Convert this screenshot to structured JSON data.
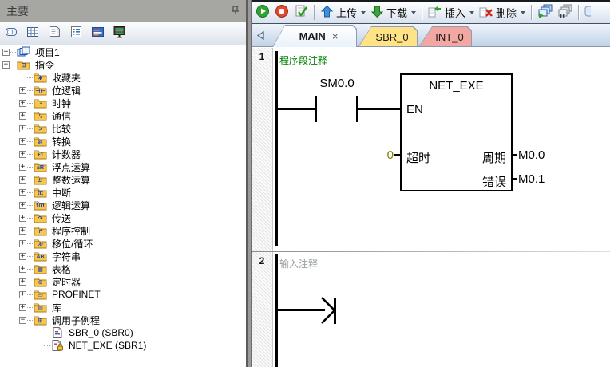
{
  "panel": {
    "title": "主要",
    "toolbar": [
      {
        "name": "frame-view-icon"
      },
      {
        "name": "grid-view-icon"
      },
      {
        "name": "document-view-icon"
      },
      {
        "name": "list-view-icon"
      },
      {
        "name": "block-view-icon"
      },
      {
        "name": "monitor-view-icon"
      }
    ]
  },
  "tree": {
    "items": [
      {
        "label": "项目1",
        "level": 0,
        "expand": "plus",
        "icon": "project",
        "glyph": ""
      },
      {
        "label": "指令",
        "level": 0,
        "expand": "minus",
        "icon": "folder",
        "glyph": "⊡"
      },
      {
        "label": "收藏夹",
        "level": 1,
        "expand": "none",
        "icon": "folder",
        "glyph": "✱"
      },
      {
        "label": "位逻辑",
        "level": 1,
        "expand": "plus",
        "icon": "folder",
        "glyph": "⊣⊢"
      },
      {
        "label": "时钟",
        "level": 1,
        "expand": "plus",
        "icon": "folder",
        "glyph": "◔"
      },
      {
        "label": "通信",
        "level": 1,
        "expand": "plus",
        "icon": "folder",
        "glyph": "ϟ"
      },
      {
        "label": "比较",
        "level": 1,
        "expand": "plus",
        "icon": "folder",
        "glyph": ">"
      },
      {
        "label": "转换",
        "level": 1,
        "expand": "plus",
        "icon": "folder",
        "glyph": "⇄"
      },
      {
        "label": "计数器",
        "level": 1,
        "expand": "plus",
        "icon": "folder",
        "glyph": "+1"
      },
      {
        "label": "浮点运算",
        "level": 1,
        "expand": "plus",
        "icon": "folder",
        "glyph": "±R"
      },
      {
        "label": "整数运算",
        "level": 1,
        "expand": "plus",
        "icon": "folder",
        "glyph": "±I"
      },
      {
        "label": "中断",
        "level": 1,
        "expand": "plus",
        "icon": "folder",
        "glyph": "ttt"
      },
      {
        "label": "逻辑运算",
        "level": 1,
        "expand": "plus",
        "icon": "folder",
        "glyph": "101"
      },
      {
        "label": "传送",
        "level": 1,
        "expand": "plus",
        "icon": "folder",
        "glyph": "↷"
      },
      {
        "label": "程序控制",
        "level": 1,
        "expand": "plus",
        "icon": "folder",
        "glyph": "↱"
      },
      {
        "label": "移位/循环",
        "level": 1,
        "expand": "plus",
        "icon": "folder",
        "glyph": "≫"
      },
      {
        "label": "字符串",
        "level": 1,
        "expand": "plus",
        "icon": "folder",
        "glyph": "AB"
      },
      {
        "label": "表格",
        "level": 1,
        "expand": "plus",
        "icon": "folder",
        "glyph": "▦"
      },
      {
        "label": "定时器",
        "level": 1,
        "expand": "plus",
        "icon": "folder",
        "glyph": "⊙"
      },
      {
        "label": "PROFINET",
        "level": 1,
        "expand": "plus",
        "icon": "folder",
        "glyph": "▭"
      },
      {
        "label": "库",
        "level": 1,
        "expand": "plus",
        "icon": "folder",
        "glyph": "▤"
      },
      {
        "label": "调用子例程",
        "level": 1,
        "expand": "minus",
        "icon": "folder",
        "glyph": "⊞"
      },
      {
        "label": "SBR_0 (SBR0)",
        "level": 2,
        "expand": "none",
        "icon": "page",
        "glyph": ""
      },
      {
        "label": "NET_EXE (SBR1)",
        "level": 2,
        "expand": "none",
        "icon": "page-lock",
        "glyph": ""
      }
    ]
  },
  "main_toolbar": {
    "items": [
      {
        "type": "icon",
        "name": "run-button",
        "icon": "run"
      },
      {
        "type": "icon",
        "name": "stop-button",
        "icon": "stop"
      },
      {
        "type": "icon",
        "name": "compile-button",
        "icon": "compile"
      },
      {
        "type": "sep"
      },
      {
        "type": "menu",
        "name": "upload-button",
        "icon": "upload",
        "label": "上传"
      },
      {
        "type": "menu",
        "name": "download-button",
        "icon": "download",
        "label": "下载"
      },
      {
        "type": "sep"
      },
      {
        "type": "menu",
        "name": "insert-button",
        "icon": "insert",
        "label": "插入"
      },
      {
        "type": "menu",
        "name": "delete-button",
        "icon": "delete",
        "label": "删除"
      },
      {
        "type": "sep"
      },
      {
        "type": "icon",
        "name": "program-status-button",
        "icon": "cascade-run"
      },
      {
        "type": "icon",
        "name": "pause-status-button",
        "icon": "cascade-pause"
      },
      {
        "type": "sep"
      },
      {
        "type": "icon",
        "name": "clipped-button",
        "icon": "partial"
      }
    ]
  },
  "tabs": {
    "close_glyph": "×",
    "items": [
      {
        "label": "MAIN",
        "state": "active",
        "closable": true
      },
      {
        "label": "SBR_0",
        "state": "yellow",
        "closable": false
      },
      {
        "label": "INT_0",
        "state": "pink",
        "closable": false
      }
    ]
  },
  "editor": {
    "network1": {
      "number": "1",
      "comment": "程序段注释"
    },
    "network2": {
      "number": "2",
      "comment": "输入注释"
    },
    "contact_operand": "SM0.0",
    "block": {
      "title": "NET_EXE",
      "en_label": "EN",
      "input_value": "0",
      "input_label": "超时",
      "output1_label": "周期",
      "output1_operand": "M0.0",
      "output2_label": "错误",
      "output2_operand": "M0.1"
    }
  },
  "colors": {
    "comment_green": "#008000",
    "comment_gray": "#9aa0a0",
    "value_olive": "#7f7f00",
    "tab_yellow": "#ffe385",
    "tab_pink": "#f2a7a2",
    "folder_yellow": "#f7c64b",
    "panel_title_bg": "#a6a6a3"
  }
}
